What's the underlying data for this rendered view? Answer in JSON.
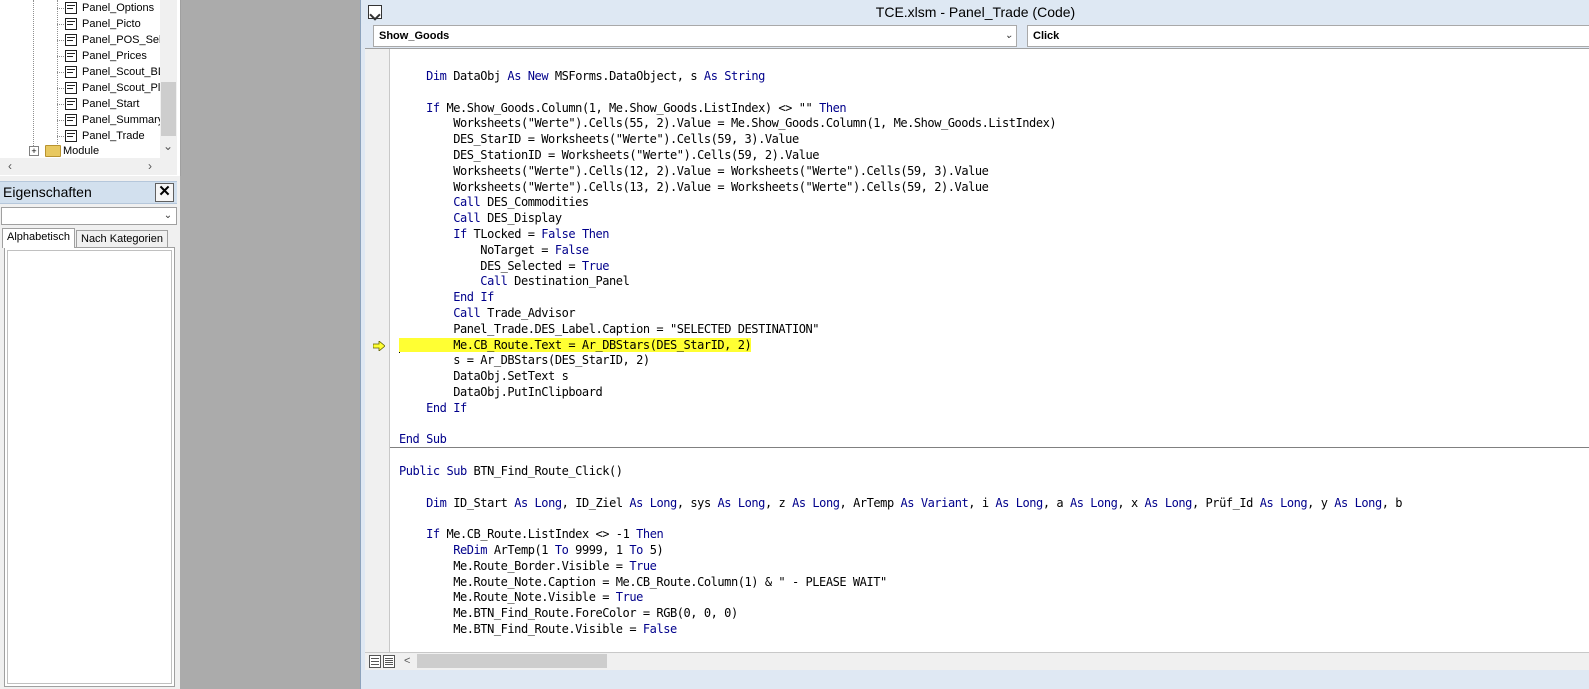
{
  "project_tree": {
    "items": [
      {
        "label": "Panel_Options"
      },
      {
        "label": "Panel_Picto"
      },
      {
        "label": "Panel_POS_Sele"
      },
      {
        "label": "Panel_Prices"
      },
      {
        "label": "Panel_Scout_BD"
      },
      {
        "label": "Panel_Scout_Pla"
      },
      {
        "label": "Panel_Start"
      },
      {
        "label": "Panel_Summary"
      },
      {
        "label": "Panel_Trade"
      }
    ],
    "folder": {
      "label": "Module"
    }
  },
  "properties": {
    "title": "Eigenschaften",
    "close_glyph": "✕",
    "tabs": [
      "Alphabetisch",
      "Nach Kategorien"
    ]
  },
  "code_window": {
    "title": "TCE.xlsm - Panel_Trade (Code)",
    "procedure_combo": "Show_Goods",
    "object_combo": "Click"
  },
  "code_lines": [
    "    Dim DataObj As New MSForms.DataObject, s As String",
    "",
    "    If Me.Show_Goods.Column(1, Me.Show_Goods.ListIndex) <> \"\" Then",
    "        Worksheets(\"Werte\").Cells(55, 2).Value = Me.Show_Goods.Column(1, Me.Show_Goods.ListIndex)",
    "        DES_StarID = Worksheets(\"Werte\").Cells(59, 3).Value",
    "        DES_StationID = Worksheets(\"Werte\").Cells(59, 2).Value",
    "        Worksheets(\"Werte\").Cells(12, 2).Value = Worksheets(\"Werte\").Cells(59, 3).Value",
    "        Worksheets(\"Werte\").Cells(13, 2).Value = Worksheets(\"Werte\").Cells(59, 2).Value",
    "        Call DES_Commodities",
    "        Call DES_Display",
    "        If TLocked = False Then",
    "            NoTarget = False",
    "            DES_Selected = True",
    "            Call Destination_Panel",
    "        End If",
    "        Call Trade_Advisor",
    "        Panel_Trade.DES_Label.Caption = \"SELECTED DESTINATION\"",
    "        Me.CB_Route.Text = Ar_DBStars(DES_StarID, 2)",
    "        s = Ar_DBStars(DES_StarID, 2)",
    "        DataObj.SetText s",
    "        DataObj.PutInClipboard",
    "    End If",
    "",
    "End Sub",
    "",
    "Public Sub BTN_Find_Route_Click()",
    "",
    "    Dim ID_Start As Long, ID_Ziel As Long, sys As Long, z As Long, ArTemp As Variant, i As Long, a As Long, x As Long, Prüf_Id As Long, y As Long, b",
    "",
    "    If Me.CB_Route.ListIndex <> -1 Then",
    "        ReDim ArTemp(1 To 9999, 1 To 5)",
    "        Me.Route_Border.Visible = True",
    "        Me.Route_Note.Caption = Me.CB_Route.Column(1) & \" - PLEASE WAIT\"",
    "        Me.Route_Note.Visible = True",
    "        Me.BTN_Find_Route.ForeColor = RGB(0, 0, 0)",
    "        Me.BTN_Find_Route.Visible = False"
  ],
  "highlighted_line_index": 17,
  "colors": {
    "keyword": "#00008b",
    "highlight": "#ffff33",
    "title_bar": "#dee8f3"
  }
}
